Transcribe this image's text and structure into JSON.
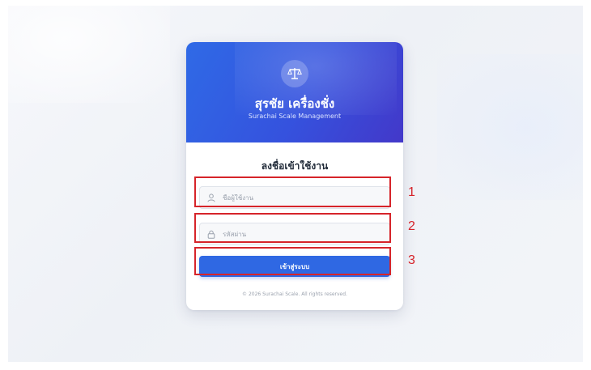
{
  "brand": {
    "title": "สุรชัย เครื่องชั่ง",
    "subtitle": "Surachai Scale Management",
    "logo_icon": "scale-icon"
  },
  "form": {
    "title": "ลงชื่อเข้าใช้งาน",
    "username_placeholder": "ชื่อผู้ใช้งาน",
    "password_placeholder": "รหัสผ่าน",
    "username_icon": "user-icon",
    "password_icon": "lock-icon",
    "submit_label": "เข้าสู่ระบบ"
  },
  "footer": {
    "copyright": "© 2026 Surachai Scale. All rights reserved."
  },
  "annotations": {
    "labels": [
      "1",
      "2",
      "3"
    ],
    "color": "#d6242a"
  },
  "colors": {
    "header_start": "#2f6ae6",
    "header_end": "#4338c9",
    "button": "#2f68e3"
  }
}
